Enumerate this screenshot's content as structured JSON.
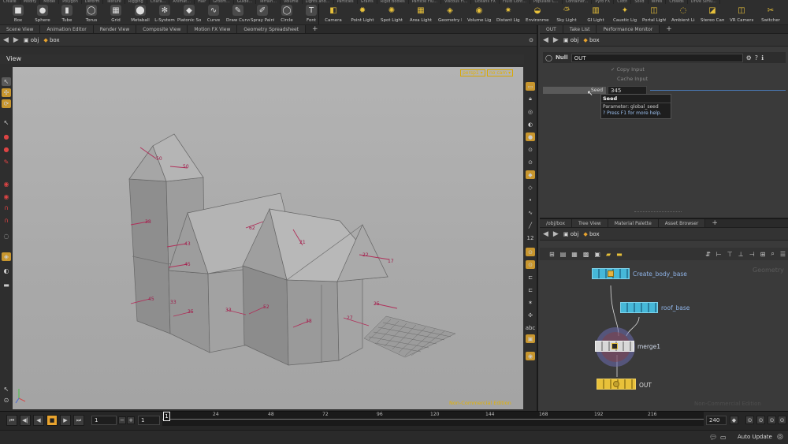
{
  "shelf": {
    "tabs": [
      "Create",
      "Modify",
      "Model",
      "Polygon",
      "Deform",
      "Texture",
      "Rigging",
      "Chara...",
      "Animat...",
      "Hair",
      "Groom...",
      "Guide...",
      "Terrain...",
      "Volume",
      "Lights and...",
      "Particles",
      "Grains",
      "Rigid Bodies",
      "Particle Flu...",
      "Viscous Fl...",
      "Oceans FX",
      "Fluid Cont...",
      "Populate C...",
      "Container...",
      "Pyro FX",
      "Cloth",
      "Solid",
      "Wires",
      "Crowds",
      "Drive Simu..."
    ],
    "left_tools": [
      "Box",
      "Sphere",
      "Tube",
      "Torus",
      "Grid",
      "Metaball",
      "L-System",
      "Platonic Sol...",
      "Curve",
      "Draw Curve",
      "Spray Paint",
      "Circle",
      "Font"
    ],
    "right_tools": [
      "Camera",
      "Point Light",
      "Spot Light",
      "Area Light",
      "Geometry L...",
      "Volume Light",
      "Distant Light",
      "Environmen...",
      "Sky Light",
      "GI Light",
      "Caustic Light",
      "Portal Light",
      "Ambient Lig...",
      "Stereo Cam...",
      "VR Camera",
      "Switcher"
    ]
  },
  "left_pane": {
    "tabs": [
      "Scene View",
      "Animation Editor",
      "Render View",
      "Composite View",
      "Motion FX View",
      "Geometry Spreadsheet"
    ],
    "path": [
      "obj",
      "box"
    ],
    "view_label": "View",
    "camera_menu": "persp1",
    "cam_menu": "no cam",
    "watermark": "Non-Commercial Edition",
    "point_labels": [
      "50",
      "50",
      "38",
      "43",
      "45",
      "45",
      "35",
      "33",
      "52",
      "38",
      "27",
      "25",
      "62",
      "21",
      "22",
      "33",
      "17"
    ]
  },
  "params_pane": {
    "tabs": [
      "OUT",
      "Take List",
      "Performance Monitor"
    ],
    "path": [
      "obj",
      "box"
    ],
    "node_type": "Null",
    "node_name": "OUT",
    "copy_input": "Copy Input",
    "cache_input": "Cache Input",
    "seed_label": "Seed",
    "seed_value": "345",
    "tooltip": {
      "title": "Seed",
      "parameter": "Parameter: global_seed",
      "help": "Press F1 for more help."
    }
  },
  "network_pane": {
    "tabs": [
      "/obj/box",
      "Tree View",
      "Material Palette",
      "Asset Browser"
    ],
    "path": [
      "obj",
      "box"
    ],
    "context_label": "Geometry",
    "watermark": "Non-Commercial Edition",
    "nodes": [
      "Create_body_base",
      "roof_base",
      "merge1",
      "OUT"
    ]
  },
  "timeline": {
    "current_frame": "1",
    "start_frame": "1",
    "marker": "1",
    "ticks": [
      "24",
      "48",
      "72",
      "96",
      "120",
      "144",
      "168",
      "192",
      "216"
    ],
    "end_frame": "240",
    "auto_update": "Auto Update"
  },
  "colors": {
    "node_blue": "#46b8d8",
    "node_yellow": "#e8c13a",
    "accent_orange": "#e8a32e",
    "label_blue": "#8fb4e8"
  }
}
